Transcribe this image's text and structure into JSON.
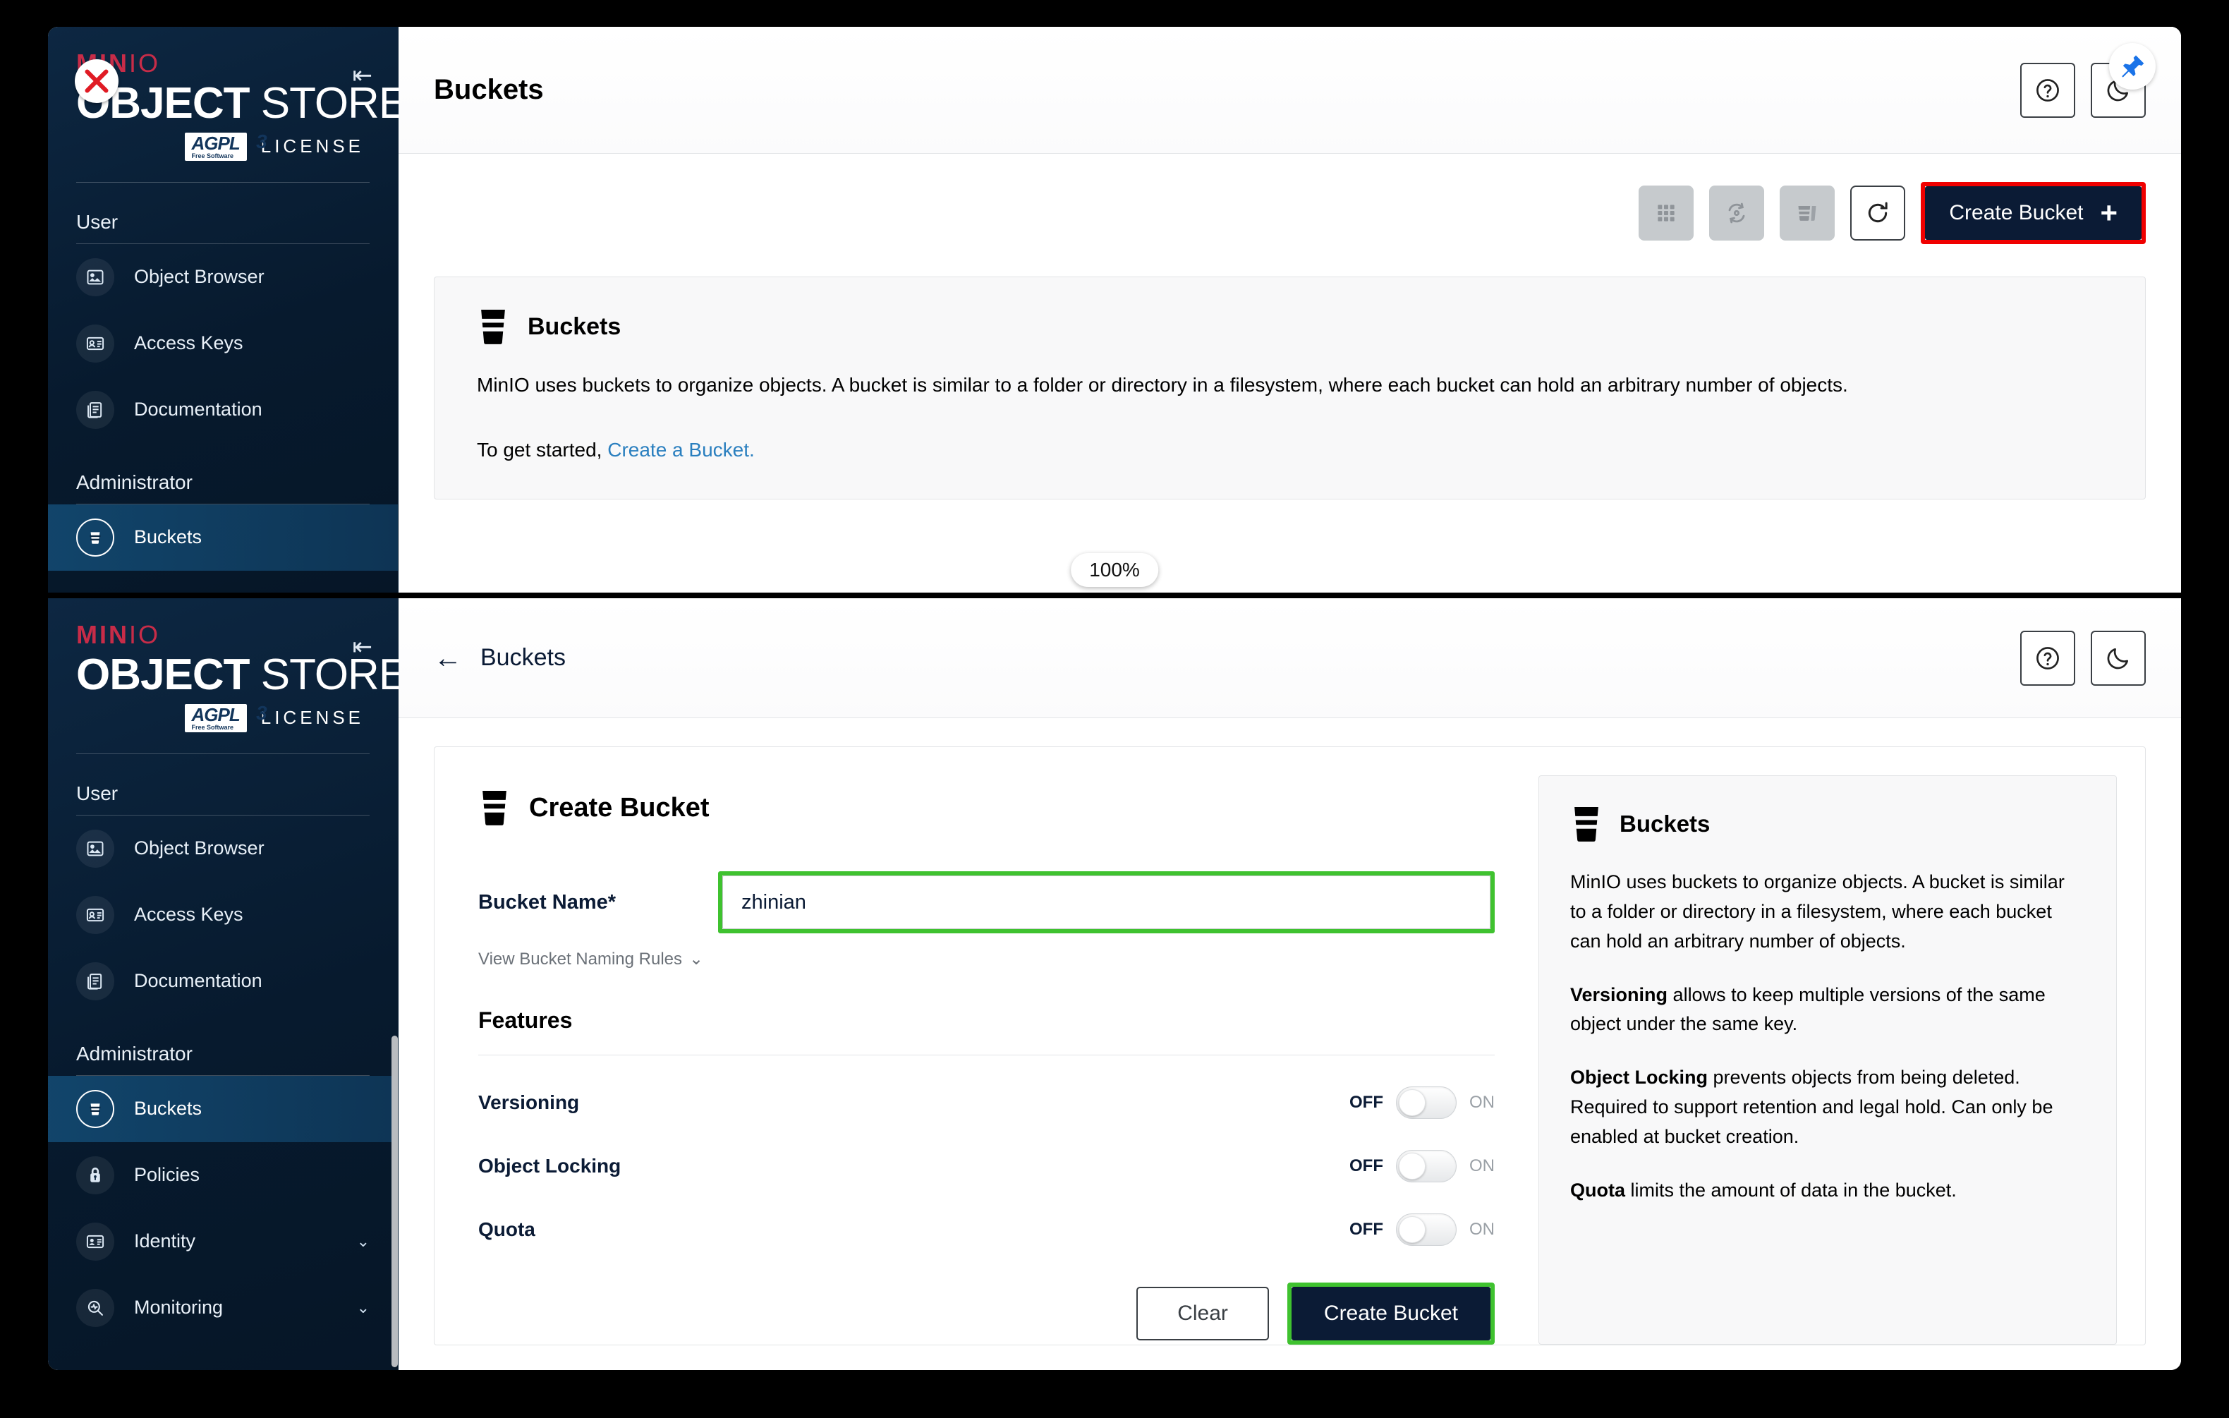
{
  "brand": {
    "minio": "MIN",
    "minio_io": "IO",
    "object": "OBJECT",
    "store": "STORE",
    "agpl": "AGPL",
    "agpl_sub": "Free Software",
    "agpl_v3": "3",
    "license": "LICENSE",
    "collapse_icon": "collapse-sidebar-icon",
    "close_icon": "close-x-icon"
  },
  "sidebar": {
    "sections": [
      {
        "title": "User"
      },
      {
        "title": "Administrator"
      }
    ],
    "user_items": [
      {
        "label": "Object Browser",
        "icon": "object-browser-icon"
      },
      {
        "label": "Access Keys",
        "icon": "access-keys-icon"
      },
      {
        "label": "Documentation",
        "icon": "documentation-icon"
      }
    ],
    "admin_items_top": [
      {
        "label": "Buckets",
        "icon": "bucket-icon",
        "active": true
      }
    ],
    "admin_items_full": [
      {
        "label": "Buckets",
        "icon": "bucket-icon",
        "active": true,
        "chevron": ""
      },
      {
        "label": "Policies",
        "icon": "lock-icon",
        "active": false,
        "chevron": ""
      },
      {
        "label": "Identity",
        "icon": "identity-icon",
        "active": false,
        "chevron": "⌄"
      },
      {
        "label": "Monitoring",
        "icon": "monitoring-icon",
        "active": false,
        "chevron": "⌄"
      }
    ]
  },
  "top_panel": {
    "page_title": "Buckets",
    "help_button_icon": "question-mark-icon",
    "dark_mode_icon": "moon-icon",
    "pin_icon": "pin-icon",
    "toolbar": {
      "grid_view_label": "grid-view",
      "sync_label": "sync",
      "delete_bucket_label": "delete-bucket",
      "refresh_label": "refresh",
      "create_bucket_label": "Create Bucket",
      "create_bucket_plus": "+",
      "highlight_color": "#f00000"
    },
    "info": {
      "title": "Buckets",
      "paragraph": "MinIO uses buckets to organize objects. A bucket is similar to a folder or directory in a filesystem, where each bucket can hold an arbitrary number of objects.",
      "cta_prefix": "To get started, ",
      "cta_link": "Create a Bucket."
    }
  },
  "zoom_pill": "100%",
  "bottom_panel": {
    "back_label": "Buckets",
    "back_icon": "arrow-left-icon",
    "help_button_icon": "question-mark-icon",
    "dark_mode_icon": "moon-icon",
    "form": {
      "title": "Create Bucket",
      "bucket_name_label": "Bucket Name*",
      "bucket_name_value": "zhinian",
      "bucket_name_placeholder": "",
      "bucket_name_highlight_color": "#3fc22f",
      "naming_rules_label": "View Bucket Naming Rules",
      "naming_rules_chevron": "⌄",
      "features_title": "Features",
      "toggles": [
        {
          "name": "Versioning",
          "off_label": "OFF",
          "on_label": "ON",
          "state": "off"
        },
        {
          "name": "Object Locking",
          "off_label": "OFF",
          "on_label": "ON",
          "state": "off"
        },
        {
          "name": "Quota",
          "off_label": "OFF",
          "on_label": "ON",
          "state": "off"
        }
      ],
      "clear_label": "Clear",
      "create_label": "Create Bucket",
      "create_highlight_color": "#3fc22f"
    },
    "help": {
      "title": "Buckets",
      "p1": "MinIO uses buckets to organize objects. A bucket is similar to a folder or directory in a filesystem, where each bucket can hold an arbitrary number of objects.",
      "p2_bold": "Versioning",
      "p2_rest": " allows to keep multiple versions of the same object under the same key.",
      "p3_bold": "Object Locking",
      "p3_rest": " prevents objects from being deleted. Required to support retention and legal hold. Can only be enabled at bucket creation.",
      "p4_bold": "Quota",
      "p4_rest": " limits the amount of data in the bucket."
    }
  }
}
